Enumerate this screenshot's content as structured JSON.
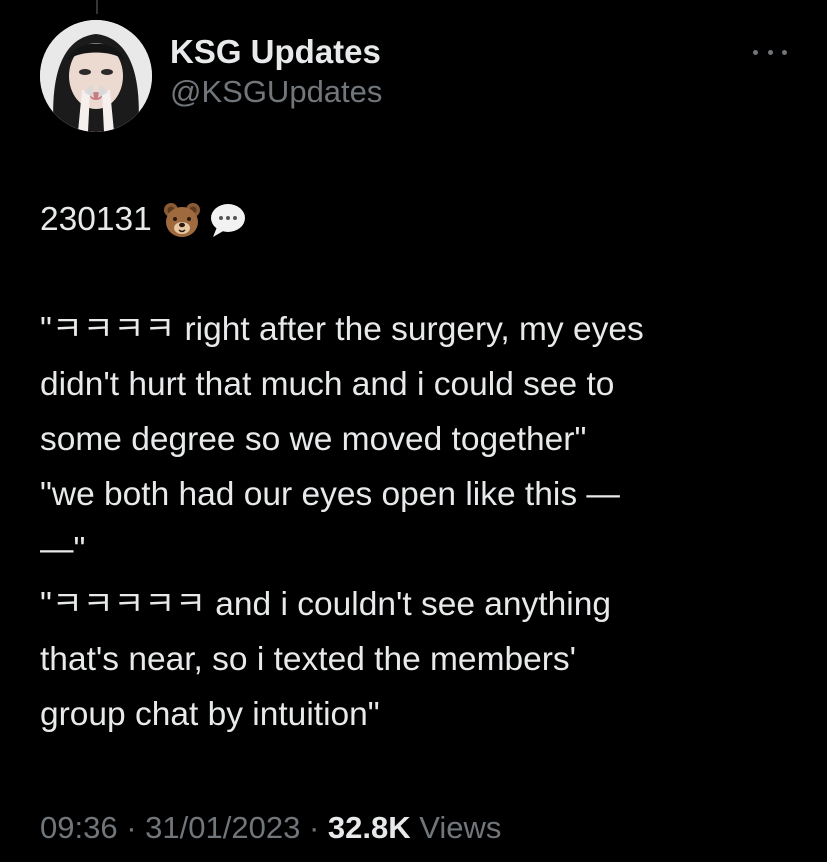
{
  "author": {
    "display_name": "KSG Updates",
    "handle": "@KSGUpdates"
  },
  "tweet": {
    "date_code": "230131",
    "emojis": [
      "bear-face-icon",
      "speech-balloon-icon"
    ],
    "lines": [
      "\"ㅋㅋㅋㅋ right after the surgery, my eyes",
      "didn't hurt that much and i could see to",
      "some degree so we moved together\"",
      "\"we both had our eyes open like this —",
      "—\"",
      "\"ㅋㅋㅋㅋㅋ and i couldn't see anything",
      "that's near, so i texted the members'",
      "group chat by intuition\""
    ]
  },
  "meta": {
    "time": "09:36",
    "separator": "·",
    "date": "31/01/2023",
    "views_count": "32.8K",
    "views_label": "Views"
  },
  "colors": {
    "background": "#000000",
    "primary_text": "#e7e9ea",
    "secondary_text": "#71767b"
  }
}
